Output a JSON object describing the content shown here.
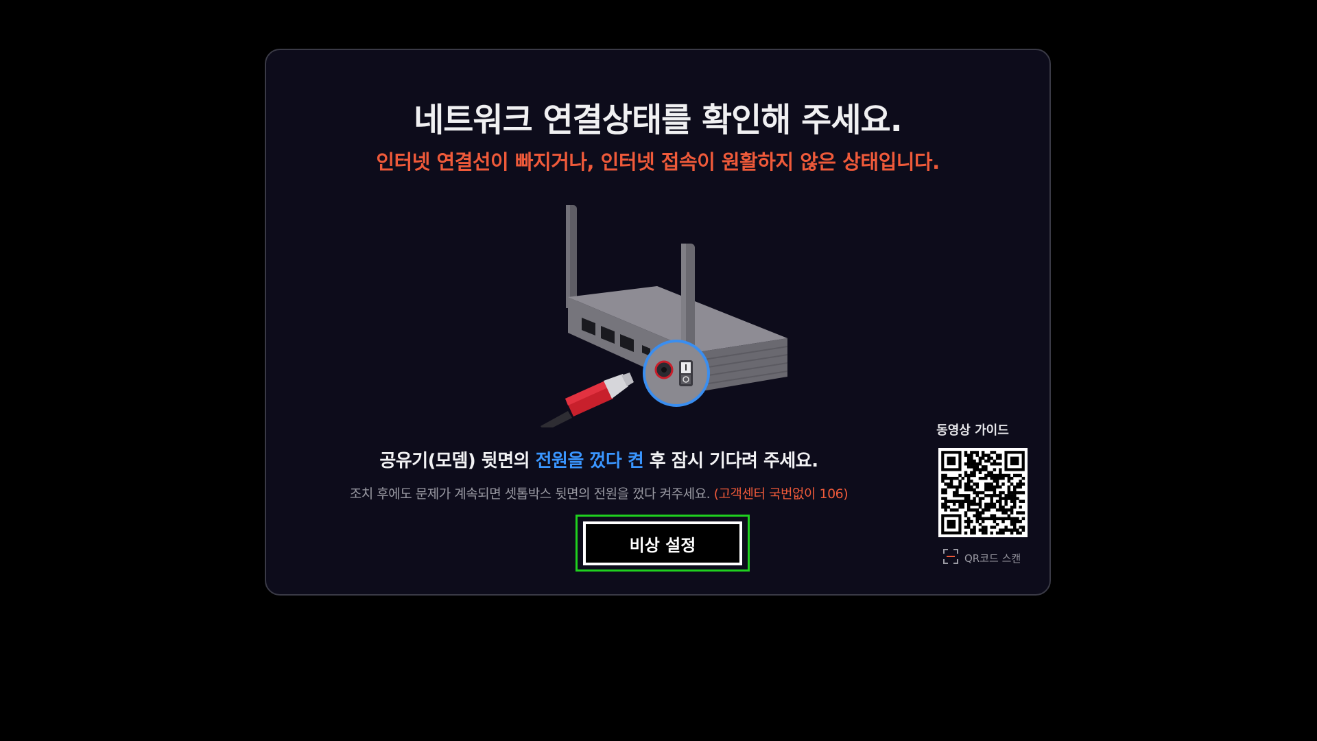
{
  "dialog": {
    "title": "네트워크 연결상태를 확인해 주세요.",
    "subtitle": "인터넷 연결선이 빠지거나, 인터넷 접속이 원활하지 않은 상태입니다.",
    "instruction": {
      "before": "공유기(모뎀) 뒷면의 ",
      "highlight": "전원을 껐다 켠",
      "after": " 후 잠시 기다려 주세요."
    },
    "note": {
      "text": "조치 후에도 문제가 계속되면 셋톱박스 뒷면의 전원을 껐다 켜주세요. ",
      "support": "(고객센터 국번없이 106)"
    },
    "emergency_button_label": "비상 설정",
    "illustration_icon": "router-icon"
  },
  "qr": {
    "title": "동영상 가이드",
    "hint": "QR코드 스캔",
    "icon": "scan-frame-icon"
  },
  "colors": {
    "background": "#000000",
    "dialog_bg": "#0d0c1b",
    "warning": "#ef5a3a",
    "highlight": "#3a96ff",
    "focus": "#1fd11f"
  }
}
